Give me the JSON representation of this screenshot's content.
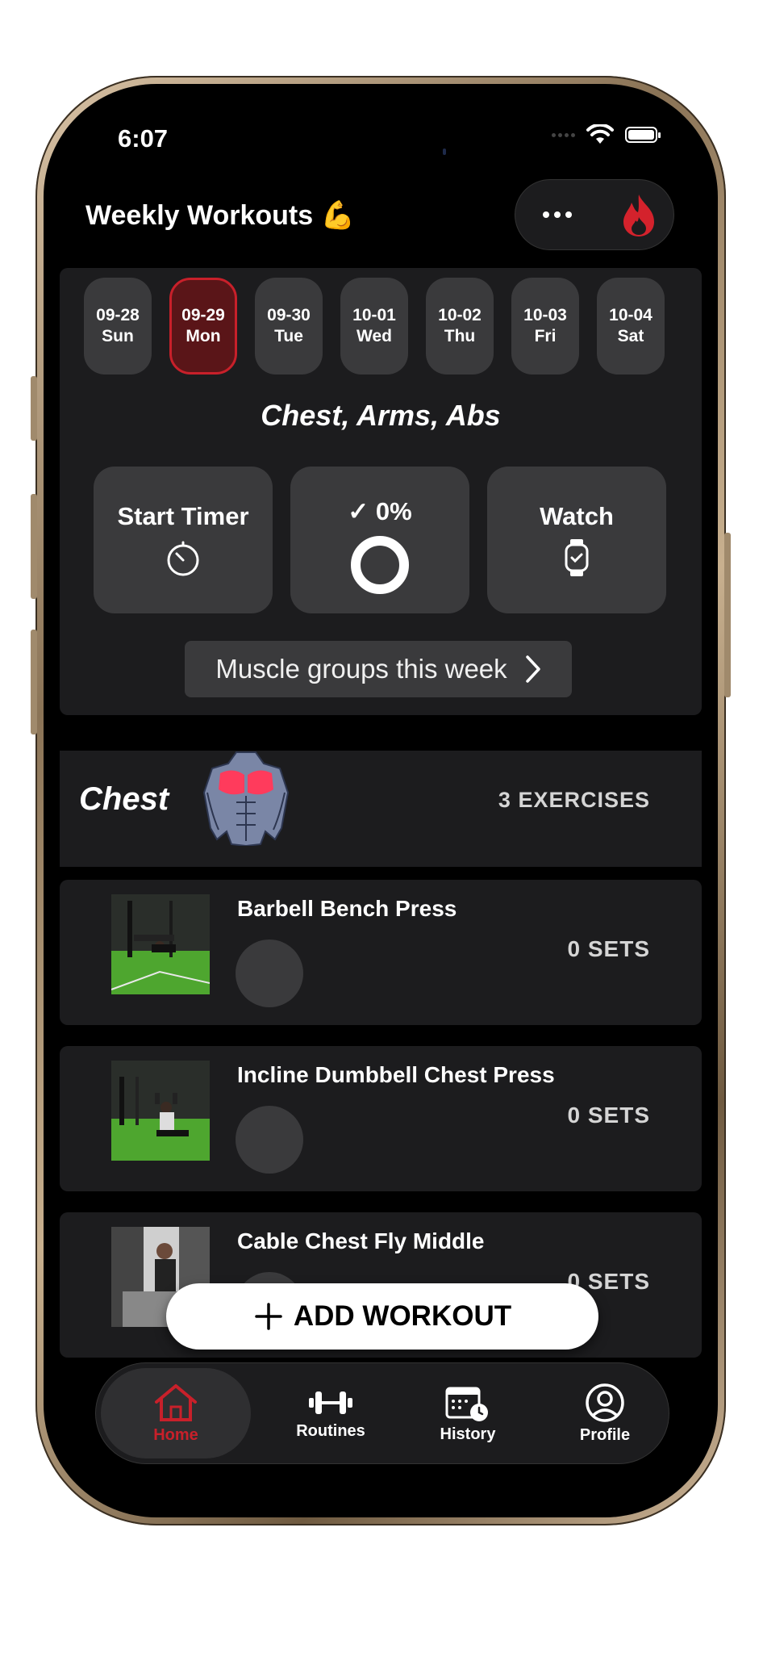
{
  "status_bar": {
    "time": "6:07"
  },
  "header": {
    "title": "Weekly Workouts 💪",
    "more_icon": "more-horizontal-icon",
    "streak_icon": "flame-icon",
    "accent": "#c8202a"
  },
  "week": {
    "days": [
      {
        "date": "09-28",
        "weekday": "Sun",
        "selected": false
      },
      {
        "date": "09-29",
        "weekday": "Mon",
        "selected": true
      },
      {
        "date": "09-30",
        "weekday": "Tue",
        "selected": false
      },
      {
        "date": "10-01",
        "weekday": "Wed",
        "selected": false
      },
      {
        "date": "10-02",
        "weekday": "Thu",
        "selected": false
      },
      {
        "date": "10-03",
        "weekday": "Fri",
        "selected": false
      },
      {
        "date": "10-04",
        "weekday": "Sat",
        "selected": false
      }
    ],
    "focus": "Chest, Arms, Abs"
  },
  "actions": {
    "start_timer": "Start Timer",
    "completion": "✓ 0%",
    "completion_value": 0,
    "watch": "Watch",
    "muscle_groups_link": "Muscle groups this week"
  },
  "section": {
    "title": "Chest",
    "count": "3 EXERCISES"
  },
  "exercises": [
    {
      "name": "Barbell Bench Press",
      "sets": "0 SETS"
    },
    {
      "name": "Incline Dumbbell Chest Press",
      "sets": "0 SETS"
    },
    {
      "name": "Cable Chest Fly Middle",
      "sets": "0 SETS"
    }
  ],
  "add_workout": {
    "label": "ADD WORKOUT"
  },
  "tabbar": {
    "tabs": [
      {
        "label": "Home",
        "icon": "home-icon",
        "active": true
      },
      {
        "label": "Routines",
        "icon": "dumbbell-icon",
        "active": false
      },
      {
        "label": "History",
        "icon": "calendar-clock-icon",
        "active": false
      },
      {
        "label": "Profile",
        "icon": "profile-icon",
        "active": false
      }
    ]
  }
}
